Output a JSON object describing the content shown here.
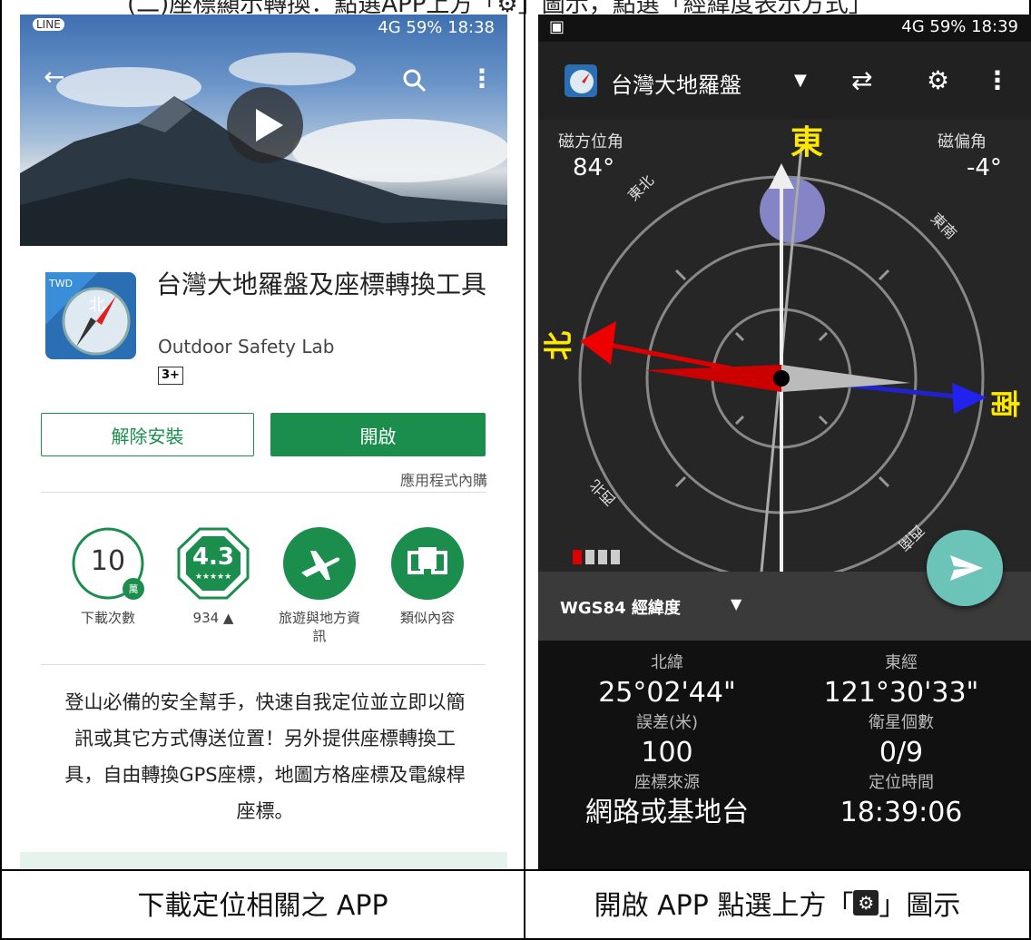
{
  "top_caption": "(二)座標顯示轉換：點選APP上方「⚙」圖示，點選「經緯度表示方式」",
  "captions": {
    "left": "下載定位相關之 APP",
    "right_before": "開啟 APP 點選上方「",
    "right_after": "」圖示"
  },
  "left_phone": {
    "status": {
      "left": "LINE",
      "right": "4G 59% 18:38"
    },
    "app_title": "台灣大地羅盤及座標轉換工具",
    "developer": "Outdoor Safety Lab",
    "content_rating": "3+",
    "uninstall_label": "解除安裝",
    "open_label": "開啟",
    "in_app_purchase": "應用程式內購",
    "stats": [
      {
        "value": "10",
        "badge": "萬",
        "label": "下載次數"
      },
      {
        "value": "4.3",
        "stars": "★★★★★",
        "label": "934 ▲"
      },
      {
        "label": "旅遊與地方資訊"
      },
      {
        "label": "類似內容"
      }
    ],
    "description": "登山必備的安全幫手，快速自我定位並立即以簡訊或其它方式傳送位置！另外提供座標轉換工具，自由轉換GPS座標，地圖方格座標及電線桿座標。"
  },
  "right_phone": {
    "status": {
      "right": "4G 59% 18:39"
    },
    "app_name": "台灣大地羅盤",
    "magnetic_bearing_label": "磁方位角",
    "magnetic_bearing_value": "84°",
    "declination_label": "磁偏角",
    "declination_value": "-4°",
    "dir_east": "東",
    "dir_north": "北",
    "dir_south": "南",
    "dir_ne": "東北",
    "dir_se": "東南",
    "dir_nw": "西北",
    "dir_sw": "西南",
    "coord_format": "WGS84 經緯度",
    "lat_label": "北緯",
    "lat_value": "25°02'44\"",
    "lon_label": "東經",
    "lon_value": "121°30'33\"",
    "error_label": "誤差(米)",
    "error_value": "100",
    "sat_label": "衛星個數",
    "sat_value": "0/9",
    "source_label": "座標來源",
    "source_value": "網路或基地台",
    "time_label": "定位時間",
    "time_value": "18:39:06"
  }
}
